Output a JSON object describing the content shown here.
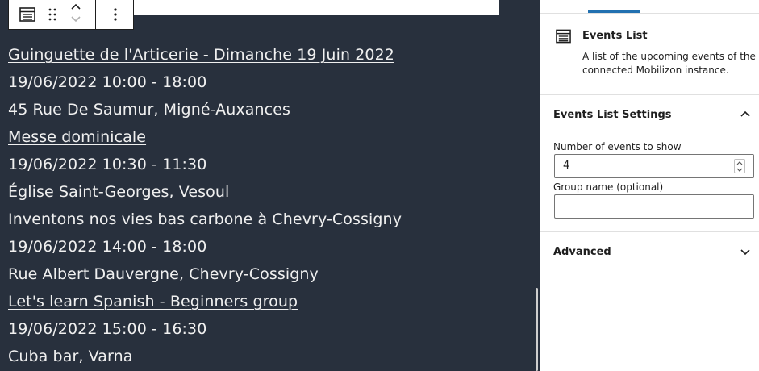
{
  "editor": {
    "events": [
      {
        "title": "Guinguette de l'Articerie - Dimanche 19 Juin 2022",
        "time": "19/06/2022 10:00 - 18:00",
        "location": "45 Rue De Saumur, Migné-Auxances"
      },
      {
        "title": "Messe dominicale",
        "time": "19/06/2022 10:30 - 11:30",
        "location": "Église Saint-Georges, Vesoul"
      },
      {
        "title": "Inventons nos vies bas carbone à Chevry-Cossigny",
        "time": "19/06/2022 14:00 - 18:00",
        "location": "Rue Albert Dauvergne, Chevry-Cossigny"
      },
      {
        "title": "Let's learn Spanish - Beginners group",
        "time": "19/06/2022 15:00 - 16:30",
        "location": "Cuba bar, Varna"
      }
    ]
  },
  "sidebar": {
    "block_title": "Events List",
    "block_description": "A list of the upcoming events of the connected Mobilizon instance.",
    "settings_panel_title": "Events List Settings",
    "number_label": "Number of events to show",
    "number_value": "4",
    "group_label": "Group name (optional)",
    "group_value": "",
    "advanced_title": "Advanced"
  },
  "colors": {
    "canvas_bg": "#28303d",
    "text": "#f0f0f0",
    "accent": "#2271b1"
  }
}
